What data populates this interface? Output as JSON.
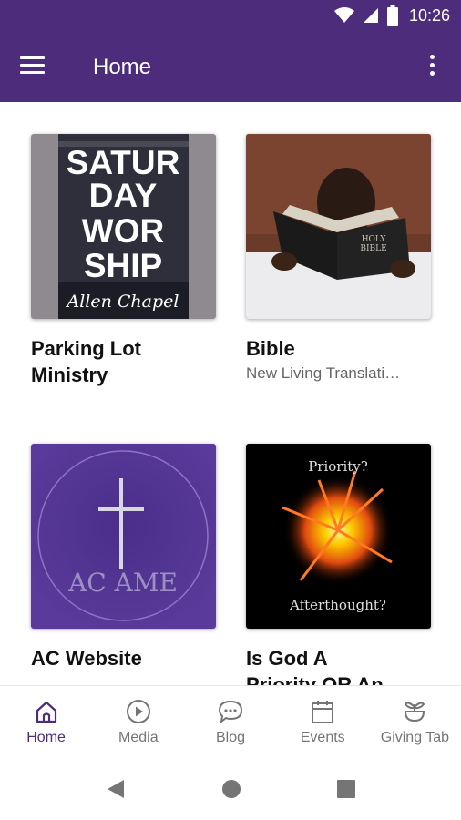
{
  "status_bar": {
    "time": "10:26"
  },
  "app_bar": {
    "title": "Home"
  },
  "cards": [
    {
      "image": {
        "line1": "SATUR",
        "line2": "DAY",
        "line3": "WOR",
        "line4": "SHIP",
        "script": "Allen Chapel"
      },
      "title_line1": "Parking Lot",
      "title_line2": "Ministry",
      "subtitle": ""
    },
    {
      "image": {
        "book_text1": "HOLY",
        "book_text2": "BIBLE"
      },
      "title_line1": "Bible",
      "title_line2": "",
      "subtitle": "New Living Translati…"
    },
    {
      "image": {
        "logo_text": "AC AME"
      },
      "title_line1": "AC Website",
      "title_line2": "",
      "subtitle": ""
    },
    {
      "image": {
        "top_text": "Priority?",
        "bottom_text": "Afterthought?"
      },
      "title_line1": "Is God A",
      "title_line2": "Priority OR An…",
      "subtitle": ""
    }
  ],
  "bottom_nav": [
    {
      "label": "Home",
      "icon": "home-icon",
      "active": true
    },
    {
      "label": "Media",
      "icon": "play-icon"
    },
    {
      "label": "Blog",
      "icon": "chat-icon"
    },
    {
      "label": "Events",
      "icon": "calendar-icon"
    },
    {
      "label": "Giving Tab",
      "icon": "sprout-icon"
    }
  ],
  "colors": {
    "primary": "#4e2c7c",
    "inactive": "#757575"
  }
}
